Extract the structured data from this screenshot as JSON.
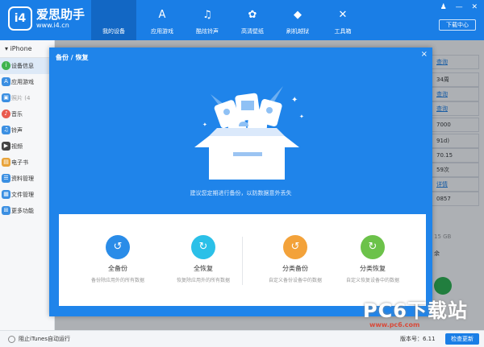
{
  "app": {
    "logo_mark": "i4",
    "name": "爱思助手",
    "url": "www.i4.cn"
  },
  "nav": [
    {
      "label": "我的设备",
      "icon": "apple-icon",
      "glyph": ""
    },
    {
      "label": "应用游戏",
      "icon": "app-store-icon",
      "glyph": "A"
    },
    {
      "label": "酷炫铃声",
      "icon": "bell-icon",
      "glyph": "♫"
    },
    {
      "label": "高清壁纸",
      "icon": "wallpaper-icon",
      "glyph": "✿"
    },
    {
      "label": "刷机越狱",
      "icon": "dropbox-icon",
      "glyph": "◆"
    },
    {
      "label": "工具箱",
      "icon": "tools-icon",
      "glyph": "✕"
    }
  ],
  "window": {
    "download_center": "下载中心",
    "controls": [
      "♟",
      "—",
      "✕"
    ]
  },
  "sidebar": {
    "device": "iPhone",
    "items": [
      {
        "label": "设备信息",
        "color": "#3fb34f",
        "glyph": "i"
      },
      {
        "label": "应用游戏",
        "color": "#3b8fe2",
        "glyph": "A"
      },
      {
        "label": "照片 (4",
        "color": "#3b8fe2",
        "glyph": "▣"
      },
      {
        "label": "音乐",
        "color": "#e95b4f",
        "glyph": "♪"
      },
      {
        "label": "铃声",
        "color": "#3b8fe2",
        "glyph": "♫"
      },
      {
        "label": "视频",
        "color": "#444",
        "glyph": "▶"
      },
      {
        "label": "电子书",
        "color": "#e8a33a",
        "glyph": "▤"
      },
      {
        "label": "资料管理",
        "color": "#3b8fe2",
        "glyph": "☰"
      },
      {
        "label": "文件管理",
        "color": "#3b8fe2",
        "glyph": "▦"
      },
      {
        "label": "更多功能",
        "color": "#3b8fe2",
        "glyph": "⊞"
      }
    ]
  },
  "background_info": [
    {
      "text": "查询",
      "link": true
    },
    {
      "text": "34周",
      "link": false
    },
    {
      "text": "查询",
      "link": true
    },
    {
      "text": "查询",
      "link": true
    },
    {
      "text": "7000",
      "link": false
    },
    {
      "text": "91d)",
      "link": false
    },
    {
      "text": "70.15",
      "link": false
    },
    {
      "text": "59次",
      "link": false
    },
    {
      "text": "详情",
      "link": true
    },
    {
      "text": "0857",
      "link": false
    }
  ],
  "storage": "15 GB",
  "storage_label": "余",
  "modal": {
    "title": "备份 / 恢复",
    "close": "×",
    "tip": "建议您定期进行备份，以防数据意外丢失",
    "options": [
      {
        "title": "全备份",
        "desc": "备份除应用外的所有数据",
        "color": "#2a8ce8",
        "icon": "backup-icon",
        "glyph": "↺"
      },
      {
        "title": "全恢复",
        "desc": "恢复除应用外的所有数据",
        "color": "#2bc0e8",
        "icon": "restore-icon",
        "glyph": "↻"
      },
      {
        "title": "分类备份",
        "desc": "自定义备份设备中的数据",
        "color": "#f3a23a",
        "icon": "category-backup-icon",
        "glyph": "↺"
      },
      {
        "title": "分类恢复",
        "desc": "自定义恢复设备中的数据",
        "color": "#6cc24a",
        "icon": "category-restore-icon",
        "glyph": "↻"
      }
    ]
  },
  "status": {
    "itunes": "阻止iTunes自动运行",
    "version": "版本号：6.11",
    "check_update": "检查更新"
  },
  "watermark": {
    "brand": "PC6下载站",
    "url": "www.pc6.com"
  }
}
